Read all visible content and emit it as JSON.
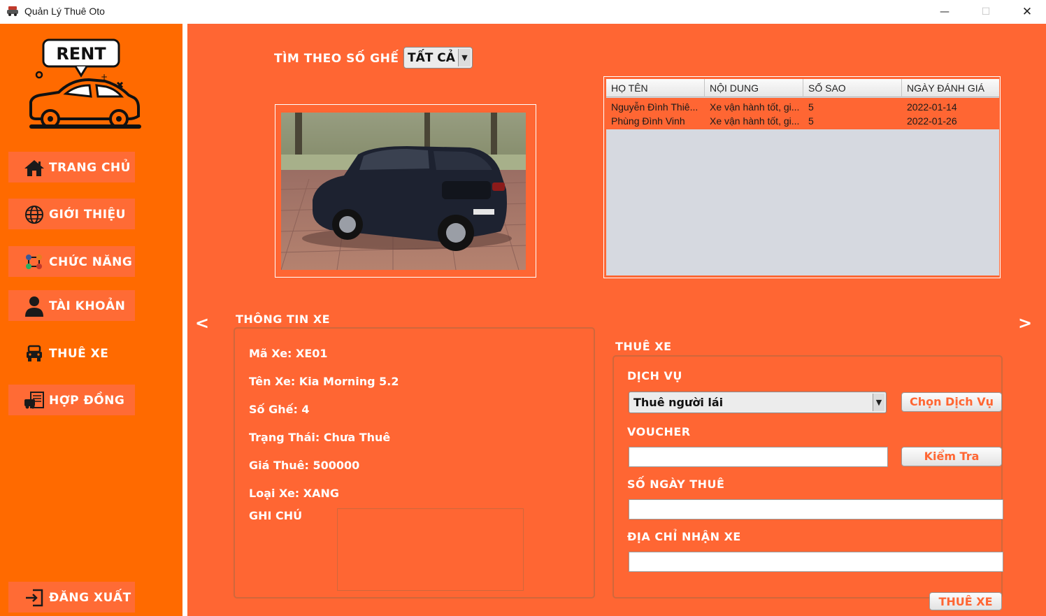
{
  "window": {
    "title": "Quản Lý Thuê Oto",
    "minimize": "—",
    "maximize": "☐",
    "close": "✕"
  },
  "sidebar": {
    "logo_text": "RENT",
    "items": [
      {
        "label": "TRANG CHỦ",
        "icon": "home-icon"
      },
      {
        "label": "GIỚI THIỆU",
        "icon": "globe-icon"
      },
      {
        "label": "CHỨC NĂNG",
        "icon": "features-icon"
      },
      {
        "label": "TÀI KHOẢN",
        "icon": "user-icon"
      },
      {
        "label": "THUÊ XE",
        "icon": "car-icon"
      },
      {
        "label": "HỢP ĐỒNG",
        "icon": "contract-icon"
      }
    ],
    "logout": {
      "label": "ĐĂNG XUẤT",
      "icon": "logout-icon"
    }
  },
  "search": {
    "label": "TÌM THEO SỐ GHẾ",
    "seat_filter": "TẤT CẢ"
  },
  "reviews": {
    "columns": [
      "HỌ TÊN",
      "NỘI DUNG",
      "SỐ SAO",
      "NGÀY ĐÁNH GIÁ"
    ],
    "rows": [
      [
        "Nguyễn Đình Thiê...",
        "Xe vận hành tốt, gi...",
        "5",
        "2022-01-14"
      ],
      [
        "Phùng Đình Vinh",
        "Xe vận hành tốt, gi...",
        "5",
        "2022-01-26"
      ]
    ]
  },
  "nav": {
    "prev": "<",
    "next": ">"
  },
  "car_info": {
    "title": "THÔNG TIN XE",
    "lines": [
      "Mã Xe: XE01",
      "Tên Xe: Kia Morning 5.2",
      "Số Ghế: 4",
      "Trạng Thái: Chưa Thuê",
      "Giá Thuê: 500000",
      "Loại Xe: XANG"
    ],
    "note_label": "GHI CHÚ"
  },
  "rent": {
    "title": "THUÊ XE",
    "service_label": "DỊCH VỤ",
    "service_value": "Thuê người lái",
    "choose_service_button": "Chọn Dịch Vụ",
    "voucher_label": "VOUCHER",
    "voucher_value": "",
    "check_button": "Kiểm Tra",
    "days_label": "SỐ NGÀY THUÊ",
    "days_value": "",
    "address_label": "ĐỊA CHỈ NHẬN XE",
    "address_value": "",
    "submit_button": "THUÊ XE"
  },
  "colors": {
    "sidebar": "#ff6a00",
    "main": "#ff6633",
    "accent_text": "#ff6633"
  }
}
